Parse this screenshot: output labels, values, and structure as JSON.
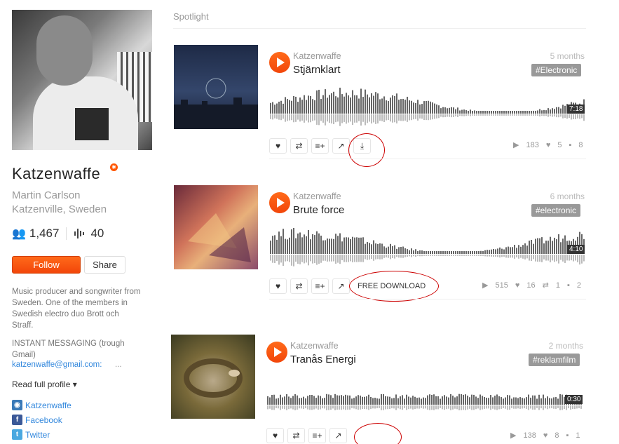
{
  "profile": {
    "name": "Katzenwaffe",
    "real_name": "Martin Carlson",
    "location": "Katzenville, Sweden",
    "followers": "1,467",
    "tracks": "40",
    "follow_label": "Follow",
    "share_label": "Share",
    "bio": "Music producer and songwriter from Sweden. One of the members in Swedish electro duo Brott och Straff.",
    "im_label": "INSTANT MESSAGING (trough Gmail)",
    "email": "katzenwaffe@gmail.com:",
    "email_more": "...",
    "read_profile": "Read full profile ▾",
    "links": [
      {
        "label": "Katzenwaffe",
        "icon": "globe-icon"
      },
      {
        "label": "Facebook",
        "icon": "facebook-icon"
      },
      {
        "label": "Twitter",
        "icon": "twitter-icon"
      }
    ]
  },
  "section_title": "Spotlight",
  "tracks": [
    {
      "artist": "Katzenwaffe",
      "title": "Stjärnklart",
      "age": "5 months",
      "tag": "#Electronic",
      "duration": "7:18",
      "plays": "183",
      "likes": "5",
      "reposts": "",
      "comments": "8",
      "download": "",
      "colors": {
        "art": "#2d3b5a"
      }
    },
    {
      "artist": "Katzenwaffe",
      "title": "Brute force",
      "age": "6 months",
      "tag": "#electronic",
      "duration": "4:10",
      "plays": "515",
      "likes": "16",
      "reposts": "1",
      "comments": "2",
      "download": "FREE DOWNLOAD",
      "colors": {
        "art": "#c96a4a"
      }
    },
    {
      "artist": "Katzenwaffe",
      "title": "Tranås Energi",
      "age": "2 months",
      "tag": "#reklamfilm",
      "duration": "0:30",
      "plays": "138",
      "likes": "8",
      "reposts": "",
      "comments": "1",
      "download": "",
      "colors": {
        "art": "#7a6a3a"
      }
    }
  ]
}
